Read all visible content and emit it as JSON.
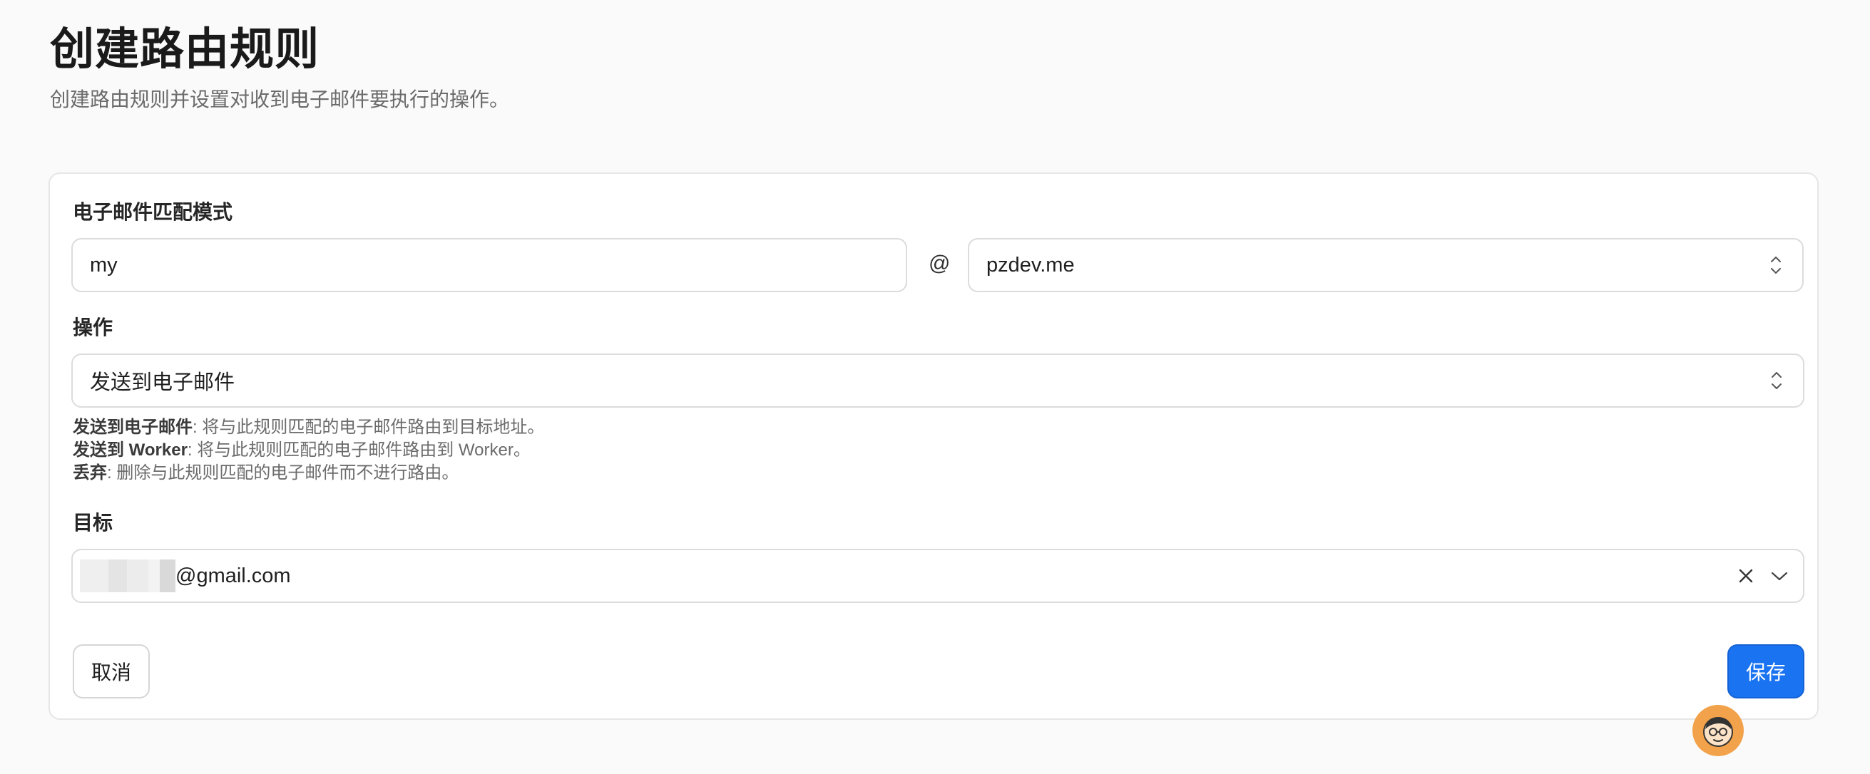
{
  "header": {
    "title": "创建路由规则",
    "subtitle": "创建路由规则并设置对收到电子邮件要执行的操作。"
  },
  "match": {
    "label": "电子邮件匹配模式",
    "local_part": "my",
    "at": "@",
    "domain": "pzdev.me"
  },
  "action": {
    "label": "操作",
    "selected": "发送到电子邮件",
    "help": [
      {
        "term": "发送到电子邮件",
        "desc": ": 将与此规则匹配的电子邮件路由到目标地址。"
      },
      {
        "term": "发送到 Worker",
        "desc": ": 将与此规则匹配的电子邮件路由到 Worker。"
      },
      {
        "term": "丢弃",
        "desc": ": 删除与此规则匹配的电子邮件而不进行路由。"
      }
    ]
  },
  "destination": {
    "label": "目标",
    "email_suffix": "@gmail.com"
  },
  "buttons": {
    "cancel": "取消",
    "save": "保存"
  },
  "colors": {
    "accent": "#1a73f0",
    "background": "#fafafa",
    "avatar_bg": "#f2a24a"
  }
}
